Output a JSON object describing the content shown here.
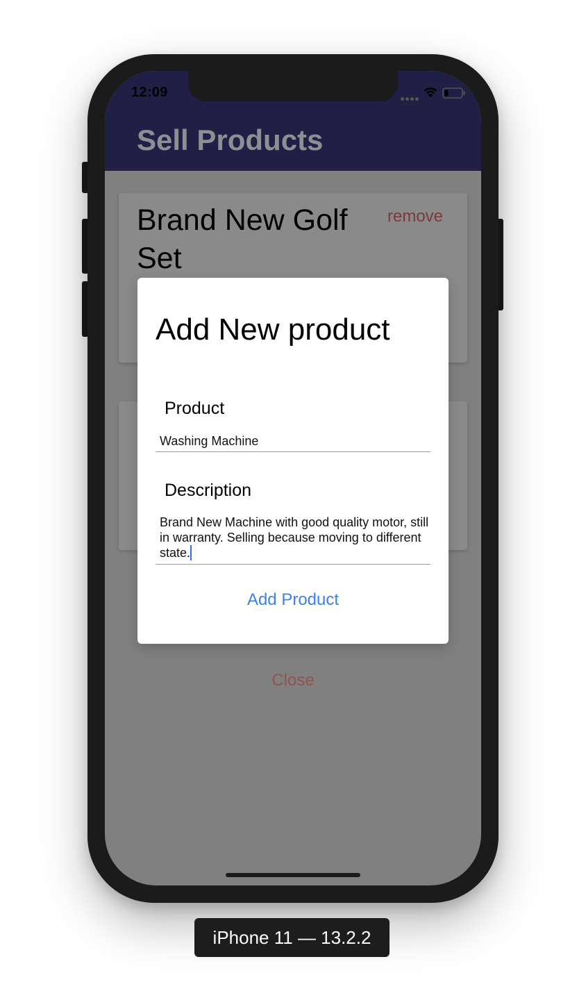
{
  "status_bar": {
    "time": "12:09"
  },
  "navbar": {
    "title": "Sell Products"
  },
  "cards": [
    {
      "title": "Brand New Golf Set",
      "remove_label": "remove"
    },
    {
      "title": "",
      "remove_label": ""
    }
  ],
  "modal": {
    "title": "Add New product",
    "product_label": "Product",
    "product_value": "Washing Machine",
    "description_label": "Description",
    "description_value": "Brand New Machine with good quality motor, still in warranty. Selling because moving to different state.",
    "submit_label": "Add Product"
  },
  "close_label": "Close",
  "device_label": "iPhone 11 — 13.2.2",
  "colors": {
    "navbar": "#221f47",
    "accent": "#3b82e8",
    "destructive": "#8f5353",
    "overlay": "#808080"
  },
  "icons": [
    "wifi-icon",
    "battery-icon",
    "cellular-signal-icon"
  ]
}
